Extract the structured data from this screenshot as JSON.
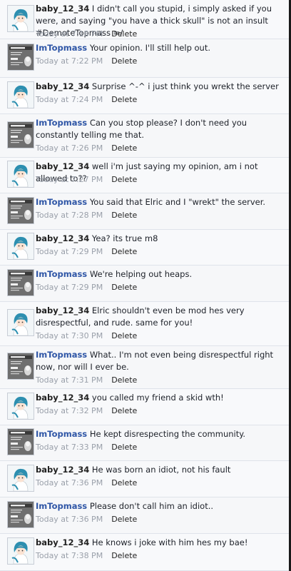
{
  "delete_label": "Delete",
  "messages": [
    {
      "author": "baby_12_34",
      "avatar": "anime-girl-avatar",
      "text": "I didn't call you stupid, i simply asked if you were, and saying \"you have a thick skull\" is not an insult #DemoteTopmass =/",
      "time": "Today at 7:18 PM"
    },
    {
      "author": "ImTopmass",
      "avatar": "darkness-poster-avatar",
      "text": "Your opinion. I'll still help out.",
      "time": "Today at 7:22 PM"
    },
    {
      "author": "baby_12_34",
      "avatar": "anime-girl-avatar",
      "text": "Surprise ^-^ i just think you wrekt the server",
      "time": "Today at 7:24 PM"
    },
    {
      "author": "ImTopmass",
      "avatar": "darkness-poster-avatar",
      "text": "Can you stop please? I don't need you constantly telling me that.",
      "time": "Today at 7:26 PM"
    },
    {
      "author": "baby_12_34",
      "avatar": "anime-girl-avatar",
      "text": "well i'm just saying my opinion, am i not allowed to??",
      "time": "Today at 7:27 PM"
    },
    {
      "author": "ImTopmass",
      "avatar": "darkness-poster-avatar",
      "text": "You said that Elric and I \"wrekt\" the server.",
      "time": "Today at 7:28 PM"
    },
    {
      "author": "baby_12_34",
      "avatar": "anime-girl-avatar",
      "text": "Yea? its true m8",
      "time": "Today at 7:29 PM"
    },
    {
      "author": "ImTopmass",
      "avatar": "darkness-poster-avatar",
      "text": "We're helping out heaps.",
      "time": "Today at 7:29 PM"
    },
    {
      "author": "baby_12_34",
      "avatar": "anime-girl-avatar",
      "text": "Elric shouldn't even be mod hes very disrespectful, and rude. same for you!",
      "time": "Today at 7:30 PM"
    },
    {
      "author": "ImTopmass",
      "avatar": "darkness-poster-avatar",
      "text": "What.. I'm not even being disrespectful right now, nor will I ever be.",
      "time": "Today at 7:31 PM"
    },
    {
      "author": "baby_12_34",
      "avatar": "anime-girl-avatar",
      "text": "you called my friend a skid wth!",
      "time": "Today at 7:32 PM"
    },
    {
      "author": "ImTopmass",
      "avatar": "darkness-poster-avatar",
      "text": "He kept disrespecting the community.",
      "time": "Today at 7:33 PM"
    },
    {
      "author": "baby_12_34",
      "avatar": "anime-girl-avatar",
      "text": "He was born an idiot, not his fault",
      "time": "Today at 7:36 PM"
    },
    {
      "author": "ImTopmass",
      "avatar": "darkness-poster-avatar",
      "text": "Please don't call him an idiot..",
      "time": "Today at 7:36 PM"
    },
    {
      "author": "baby_12_34",
      "avatar": "anime-girl-avatar",
      "text": "He knows i joke with him hes my bae!",
      "time": "Today at 7:38 PM"
    }
  ]
}
